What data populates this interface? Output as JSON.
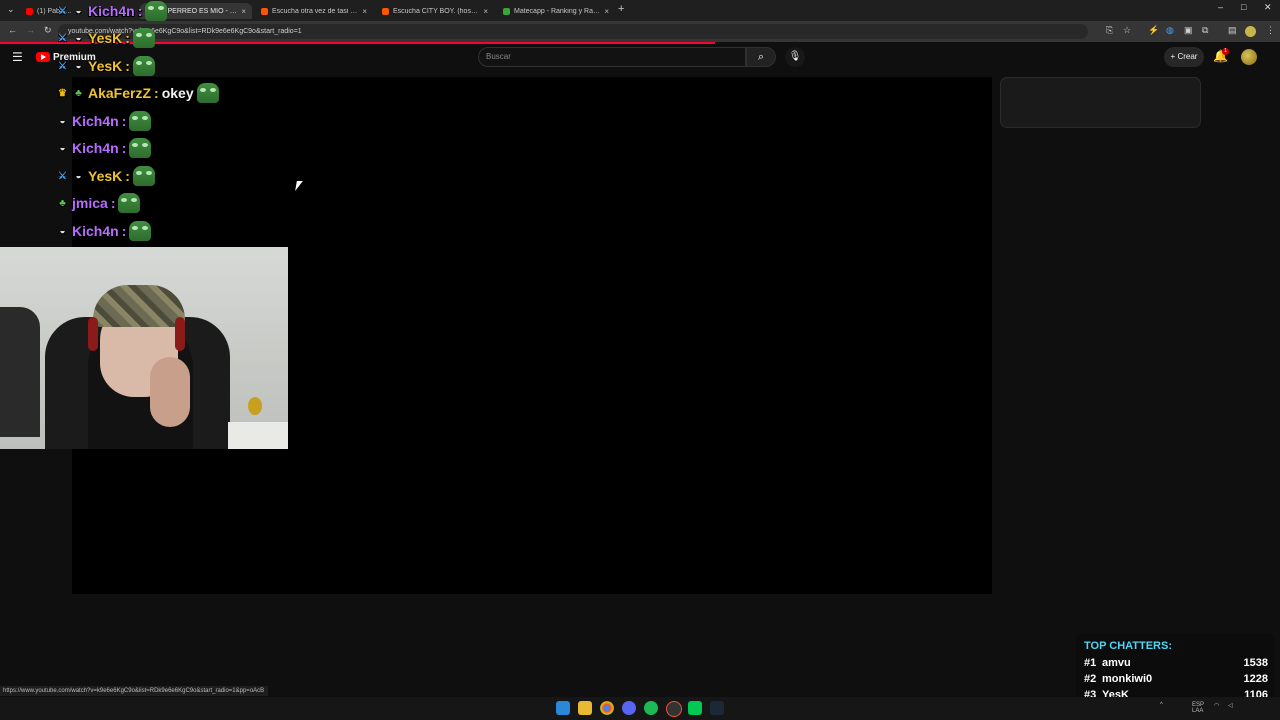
{
  "browser": {
    "tabs": [
      {
        "title": "(1) Pablo...",
        "favicon_color": "#ff0000",
        "active": false
      },
      {
        "title": "(1) PERREO ES MIO - DJNIIRO...",
        "favicon_color": "#ff0000",
        "active": true
      },
      {
        "title": "Escucha otra vez de tasi | Disfru...",
        "favicon_color": "#ff5500",
        "active": false
      },
      {
        "title": "Escucha CITY BOY. (hosted by s...",
        "favicon_color": "#ff5500",
        "active": false
      },
      {
        "title": "Matecapp - Ranking y Racha de...",
        "favicon_color": "#3aa63a",
        "active": false
      }
    ],
    "new_tab": "+",
    "close_glyph": "×",
    "window_controls": [
      "–",
      "□",
      "✕"
    ],
    "address": "youtube.com/watch?v=k9e6e6KgC9o&list=RDk9e6e6KgC9o&start_radio=1",
    "status_url": "https://www.youtube.com/watch?v=k9e6e6KgC9o&list=RDk9e6e6KgC9o&start_radio=1&pp=oAcB"
  },
  "youtube": {
    "logo_text": "Premium",
    "search_placeholder": "Buscar",
    "create_label": "Crear",
    "notification_count": "1"
  },
  "chat": [
    {
      "badges": [
        "sword",
        "bowl"
      ],
      "user": "Kich4n",
      "color": "purple",
      "message": "",
      "emote": true
    },
    {
      "badges": [
        "sword",
        "bowl"
      ],
      "user": "YesK",
      "color": "yellow",
      "message": "",
      "emote": true
    },
    {
      "badges": [
        "sword",
        "bowl"
      ],
      "user": "YesK",
      "color": "yellow",
      "message": "",
      "emote": true
    },
    {
      "badges": [
        "crown",
        "sub"
      ],
      "user": "AkaFerzZ",
      "color": "yellow",
      "message": "okey",
      "emote": true
    },
    {
      "badges": [
        "bowl"
      ],
      "user": "Kich4n",
      "color": "purple",
      "message": "",
      "emote": true
    },
    {
      "badges": [
        "bowl"
      ],
      "user": "Kich4n",
      "color": "purple",
      "message": "",
      "emote": true
    },
    {
      "badges": [
        "sword",
        "bowl"
      ],
      "user": "YesK",
      "color": "yellow",
      "message": "",
      "emote": true
    },
    {
      "badges": [
        "sub"
      ],
      "user": "jmica",
      "color": "purple",
      "message": "",
      "emote": true
    },
    {
      "badges": [
        "bowl"
      ],
      "user": "Kich4n",
      "color": "purple",
      "message": "",
      "emote": true
    }
  ],
  "top_chatters": {
    "title": "TOP CHATTERS:",
    "entries": [
      {
        "rank": "#1",
        "name": "amvu",
        "count": "1538"
      },
      {
        "rank": "#2",
        "name": "monkiwi0",
        "count": "1228"
      },
      {
        "rank": "#3",
        "name": "YesK",
        "count": "1106"
      }
    ]
  },
  "taskbar": {
    "tray_lang": "ESP LAA"
  },
  "colors": {
    "accent_red": "#ff0033",
    "chatters_title": "#4fd6f7",
    "user_purple": "#b76cff",
    "user_yellow": "#f1c232"
  }
}
